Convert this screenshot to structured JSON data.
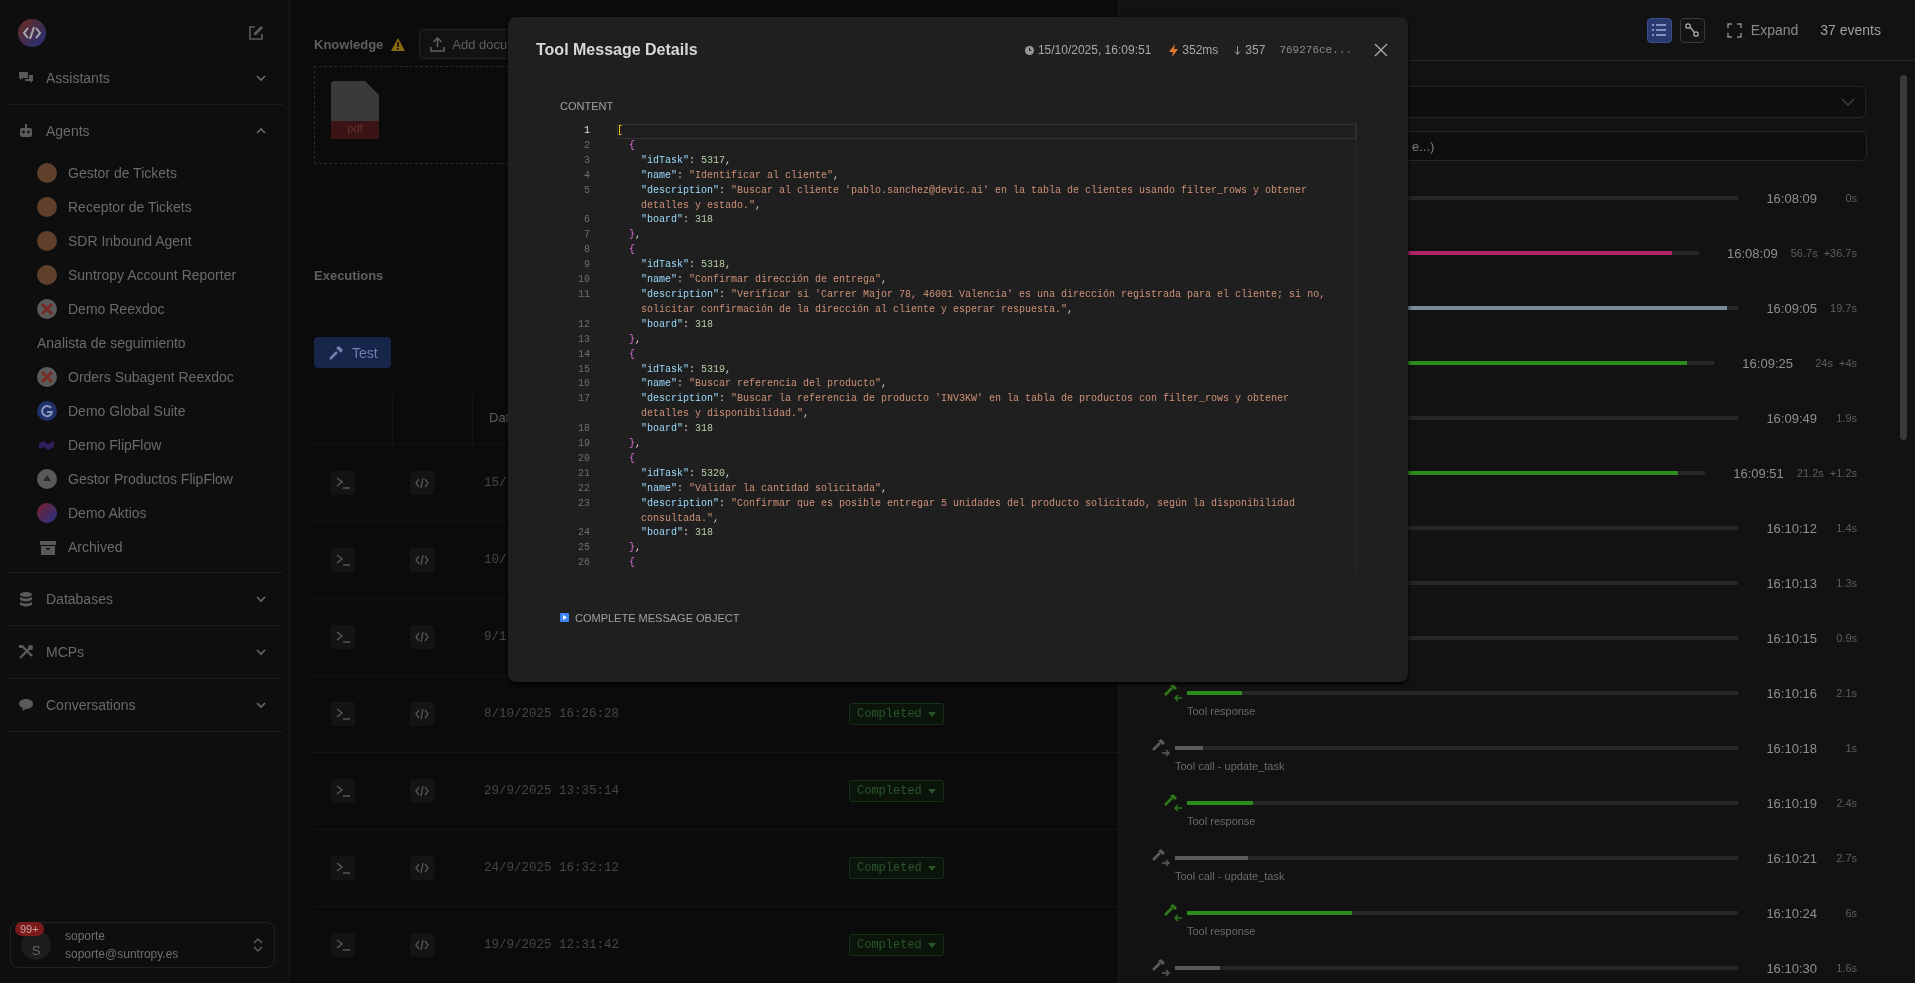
{
  "sidebar": {
    "sections": [
      {
        "label": "Assistants",
        "kind": "chat",
        "expanded": false
      },
      {
        "label": "Agents",
        "kind": "robot",
        "expanded": true,
        "items": [
          {
            "label": "Gestor de Tickets",
            "kind": "person"
          },
          {
            "label": "Receptor de Tickets",
            "kind": "person"
          },
          {
            "label": "SDR Inbound Agent",
            "kind": "person"
          },
          {
            "label": "Suntropy Account Reporter",
            "kind": "person"
          },
          {
            "label": "Demo Reexdoc",
            "kind": "x-logo"
          },
          {
            "label": "Analista de seguimiento",
            "kind": "none"
          },
          {
            "label": "Orders Subagent Reexdoc",
            "kind": "x-logo"
          },
          {
            "label": "Demo Global Suite",
            "kind": "g-logo"
          },
          {
            "label": "Demo FlipFlow",
            "kind": "flipflow-logo"
          },
          {
            "label": "Gestor Productos FlipFlow",
            "kind": "round-logo"
          },
          {
            "label": "Demo Aktios",
            "kind": "gradient-logo"
          },
          {
            "label": "Archived",
            "kind": "archive"
          }
        ]
      },
      {
        "label": "Databases",
        "kind": "database",
        "expanded": false
      },
      {
        "label": "MCPs",
        "kind": "tools",
        "expanded": false
      },
      {
        "label": "Conversations",
        "kind": "comment",
        "expanded": false
      }
    ],
    "user": {
      "badge": "99+",
      "initial": "S",
      "name": "soporte",
      "email": "soporte@suntropy.es"
    }
  },
  "knowledge": {
    "label": "Knowledge",
    "warning": true,
    "add_button": "Add docu",
    "file_label": "pdf"
  },
  "executions": {
    "title": "Executions",
    "test_button": "Test",
    "date_column": "Dat",
    "rows": [
      {
        "date": "15/"
      },
      {
        "date": "10/"
      },
      {
        "date": "9/1"
      },
      {
        "date": "8/10/2025 16:26:28",
        "status": "Completed"
      },
      {
        "date": "29/9/2025 13:35:14",
        "status": "Completed"
      },
      {
        "date": "24/9/2025 16:32:12",
        "status": "Completed"
      },
      {
        "date": "19/9/2025 12:31:42",
        "status": "Completed"
      }
    ]
  },
  "events": {
    "views": [
      {
        "kind": "list",
        "selected": true
      },
      {
        "kind": "graph",
        "selected": false
      }
    ],
    "expand": "Expand",
    "count": "37 events",
    "filter_placeholder": "e...)",
    "rows": [
      {
        "kind": "event",
        "time": "16:08:09",
        "duration": "0s"
      },
      {
        "kind": "event",
        "level": 0.95,
        "color": "#b0246a",
        "time": "16:08:09",
        "duration": "56.7s",
        "gap": "+36.7s"
      },
      {
        "kind": "event",
        "level": 0.98,
        "color": "#7a8c99",
        "time": "16:09:05",
        "duration": "19.7s"
      },
      {
        "kind": "event",
        "level": 0.95,
        "color": "#2e8b1e",
        "time": "16:09:25",
        "duration": "24s",
        "gap": "+4s"
      },
      {
        "kind": "event",
        "time": "16:09:49",
        "duration": "1.9s"
      },
      {
        "kind": "event",
        "level": 0.95,
        "color": "#2e8b1e",
        "time": "16:09:51",
        "duration": "21.2s",
        "gap": "+1.2s"
      },
      {
        "kind": "event",
        "time": "16:10:12",
        "duration": "1.4s"
      },
      {
        "kind": "event",
        "time": "16:10:13",
        "duration": "1.3s"
      },
      {
        "kind": "event",
        "time": "16:10:15",
        "duration": "0.9s"
      },
      {
        "kind": "tool_response",
        "label": "Tool response",
        "level": 0.1,
        "color": "#2e8b1e",
        "time": "16:10:16",
        "duration": "2.1s"
      },
      {
        "kind": "tool_call",
        "label": "Tool call - update_task",
        "level": 0.05,
        "color": "#5a5a5a",
        "time": "16:10:18",
        "duration": "1s"
      },
      {
        "kind": "tool_response",
        "label": "Tool response",
        "level": 0.12,
        "color": "#2e8b1e",
        "time": "16:10:19",
        "duration": "2.4s"
      },
      {
        "kind": "tool_call",
        "label": "Tool call - update_task",
        "level": 0.13,
        "color": "#5a5a5a",
        "time": "16:10:21",
        "duration": "2.7s"
      },
      {
        "kind": "tool_response",
        "label": "Tool response",
        "level": 0.3,
        "color": "#2e8b1e",
        "time": "16:10:24",
        "duration": "6s"
      },
      {
        "kind": "tool_call",
        "level": 0.08,
        "color": "#5a5a5a",
        "time": "16:10:30",
        "duration": "1.6s"
      }
    ]
  },
  "modal": {
    "title": "Tool Message Details",
    "timestamp": "15/10/2025, 16:09:51",
    "duration": "352ms",
    "tokens": "357",
    "id": "769276ce...",
    "content_label": "CONTENT",
    "lines": [
      {
        "n": "1",
        "active": true,
        "tokens": [
          {
            "kind": "open",
            "text": "["
          }
        ]
      },
      {
        "n": "2",
        "active": false,
        "tokens": [
          {
            "kind": "open",
            "text": "{"
          }
        ]
      },
      {
        "n": "3",
        "active": false,
        "tokens": [
          {
            "kind": "key",
            "text": "\"idTask\""
          },
          {
            "kind": "punct",
            "text": ": "
          },
          {
            "kind": "num",
            "text": "5317"
          },
          {
            "kind": "punct",
            "text": ","
          }
        ]
      },
      {
        "n": "4",
        "active": false,
        "tokens": [
          {
            "kind": "key",
            "text": "\"name\""
          },
          {
            "kind": "punct",
            "text": ": "
          },
          {
            "kind": "str",
            "text": "\"Identificar al cliente\""
          },
          {
            "kind": "punct",
            "text": ","
          }
        ]
      },
      {
        "n": "5",
        "active": false,
        "tokens": [
          {
            "kind": "key",
            "text": "\"description\""
          },
          {
            "kind": "punct",
            "text": ": "
          },
          {
            "kind": "str",
            "text": "\"Buscar al cliente 'pablo.sanchez@devic.ai' en la tabla de clientes usando filter_rows y obtener detalles y estado.\""
          },
          {
            "kind": "punct",
            "text": ","
          }
        ]
      },
      {
        "n": "6",
        "active": false,
        "tokens": [
          {
            "kind": "key",
            "text": "\"board\""
          },
          {
            "kind": "punct",
            "text": ": "
          },
          {
            "kind": "num",
            "text": "318"
          }
        ]
      },
      {
        "n": "7",
        "active": false,
        "tokens": [
          {
            "kind": "close",
            "text": "}"
          },
          {
            "kind": "punct",
            "text": ","
          }
        ]
      },
      {
        "n": "8",
        "active": false,
        "tokens": [
          {
            "kind": "open",
            "text": "{"
          }
        ]
      },
      {
        "n": "9",
        "active": false,
        "tokens": [
          {
            "kind": "key",
            "text": "\"idTask\""
          },
          {
            "kind": "punct",
            "text": ": "
          },
          {
            "kind": "num",
            "text": "5318"
          },
          {
            "kind": "punct",
            "text": ","
          }
        ]
      },
      {
        "n": "10",
        "active": false,
        "tokens": [
          {
            "kind": "key",
            "text": "\"name\""
          },
          {
            "kind": "punct",
            "text": ": "
          },
          {
            "kind": "str",
            "text": "\"Confirmar dirección de entrega\""
          },
          {
            "kind": "punct",
            "text": ","
          }
        ]
      },
      {
        "n": "11",
        "active": false,
        "tokens": [
          {
            "kind": "key",
            "text": "\"description\""
          },
          {
            "kind": "punct",
            "text": ": "
          },
          {
            "kind": "str",
            "text": "\"Verificar si 'Carrer Major 78, 46001 Valencia' es una dirección registrada para el cliente; si no, solicitar confirmación de la dirección al cliente y esperar respuesta.\""
          },
          {
            "kind": "punct",
            "text": ","
          }
        ]
      },
      {
        "n": "12",
        "active": false,
        "tokens": [
          {
            "kind": "key",
            "text": "\"board\""
          },
          {
            "kind": "punct",
            "text": ": "
          },
          {
            "kind": "num",
            "text": "318"
          }
        ]
      },
      {
        "n": "13",
        "active": false,
        "tokens": [
          {
            "kind": "close",
            "text": "}"
          },
          {
            "kind": "punct",
            "text": ","
          }
        ]
      },
      {
        "n": "14",
        "active": false,
        "tokens": [
          {
            "kind": "open",
            "text": "{"
          }
        ]
      },
      {
        "n": "15",
        "active": false,
        "tokens": [
          {
            "kind": "key",
            "text": "\"idTask\""
          },
          {
            "kind": "punct",
            "text": ": "
          },
          {
            "kind": "num",
            "text": "5319"
          },
          {
            "kind": "punct",
            "text": ","
          }
        ]
      },
      {
        "n": "16",
        "active": false,
        "tokens": [
          {
            "kind": "key",
            "text": "\"name\""
          },
          {
            "kind": "punct",
            "text": ": "
          },
          {
            "kind": "str",
            "text": "\"Buscar referencia del producto\""
          },
          {
            "kind": "punct",
            "text": ","
          }
        ]
      },
      {
        "n": "17",
        "active": false,
        "tokens": [
          {
            "kind": "key",
            "text": "\"description\""
          },
          {
            "kind": "punct",
            "text": ": "
          },
          {
            "kind": "str",
            "text": "\"Buscar la referencia de producto 'INV3KW' en la tabla de productos con filter_rows y obtener detalles y disponibilidad.\""
          },
          {
            "kind": "punct",
            "text": ","
          }
        ]
      },
      {
        "n": "18",
        "active": false,
        "tokens": [
          {
            "kind": "key",
            "text": "\"board\""
          },
          {
            "kind": "punct",
            "text": ": "
          },
          {
            "kind": "num",
            "text": "318"
          }
        ]
      },
      {
        "n": "19",
        "active": false,
        "tokens": [
          {
            "kind": "close",
            "text": "}"
          },
          {
            "kind": "punct",
            "text": ","
          }
        ]
      },
      {
        "n": "20",
        "active": false,
        "tokens": [
          {
            "kind": "open",
            "text": "{"
          }
        ]
      },
      {
        "n": "21",
        "active": false,
        "tokens": [
          {
            "kind": "key",
            "text": "\"idTask\""
          },
          {
            "kind": "punct",
            "text": ": "
          },
          {
            "kind": "num",
            "text": "5320"
          },
          {
            "kind": "punct",
            "text": ","
          }
        ]
      },
      {
        "n": "22",
        "active": false,
        "tokens": [
          {
            "kind": "key",
            "text": "\"name\""
          },
          {
            "kind": "punct",
            "text": ": "
          },
          {
            "kind": "str",
            "text": "\"Validar la cantidad solicitada\""
          },
          {
            "kind": "punct",
            "text": ","
          }
        ]
      },
      {
        "n": "23",
        "active": false,
        "tokens": [
          {
            "kind": "key",
            "text": "\"description\""
          },
          {
            "kind": "punct",
            "text": ": "
          },
          {
            "kind": "str",
            "text": "\"Confirmar que es posible entregar 5 unidades del producto solicitado, según la disponibilidad consultada.\""
          },
          {
            "kind": "punct",
            "text": ","
          }
        ]
      },
      {
        "n": "24",
        "active": false,
        "tokens": [
          {
            "kind": "key",
            "text": "\"board\""
          },
          {
            "kind": "punct",
            "text": ": "
          },
          {
            "kind": "num",
            "text": "318"
          }
        ]
      },
      {
        "n": "25",
        "active": false,
        "tokens": [
          {
            "kind": "close",
            "text": "}"
          },
          {
            "kind": "punct",
            "text": ","
          }
        ]
      },
      {
        "n": "26",
        "active": false,
        "tokens": [
          {
            "kind": "open",
            "text": "{"
          }
        ]
      }
    ],
    "footer": {
      "label": "COMPLETE MESSAGE OBJECT",
      "expanded": false
    }
  }
}
